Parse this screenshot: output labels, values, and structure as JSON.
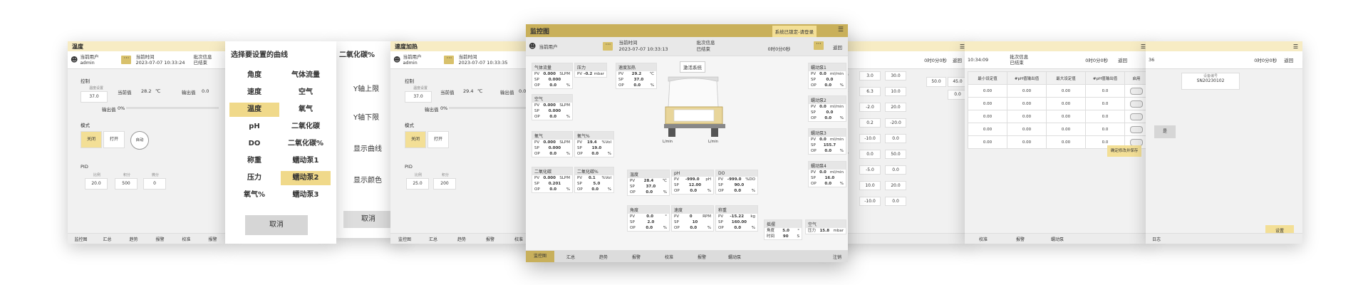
{
  "common": {
    "current_user_label": "当前用户",
    "user_name": "admin",
    "current_time_label": "当前时间",
    "current_time": "2023-07-07 10:33:24",
    "batch_info_label": "批次信息",
    "batch_status": "已结束",
    "dots": "···",
    "back": "返回"
  },
  "panel1": {
    "title": "温度",
    "control": "控制",
    "setpoint_label": "温度设置",
    "setpoint": "37.0",
    "current_value_label": "当前值",
    "current_value": "28.2",
    "unit": "℃",
    "output_label": "输出值",
    "output_value": "0.0",
    "output_value2_label": "输出值",
    "output_pct": "0%",
    "mode": "模式",
    "btn_off": "关闭",
    "btn_on": "打开",
    "btn_auto": "自动",
    "pid": "PID",
    "pid_p_label": "比例",
    "pid_i_label": "积分",
    "pid_d_label": "微分",
    "pid_p": "20.0",
    "pid_i": "500",
    "pid_d": "0",
    "nav": [
      "监控图",
      "汇总",
      "趋势",
      "报警",
      "校准",
      "报警"
    ]
  },
  "panel2": {
    "title": "选择要设置的曲线",
    "items": [
      [
        "角度",
        "气体流量"
      ],
      [
        "速度",
        "空气"
      ],
      [
        "温度",
        "氧气"
      ],
      [
        "pH",
        "二氧化碳"
      ],
      [
        "DO",
        "二氧化碳%"
      ],
      [
        "称重",
        "蠕动泵1"
      ],
      [
        "压力",
        "蠕动泵2"
      ],
      [
        "氧气%",
        "蠕动泵3"
      ]
    ],
    "cancel": "取消"
  },
  "panel3": {
    "title": "二氧化碳%",
    "y_max": "Y轴上限",
    "y_min": "Y轴下限",
    "show_curve": "显示曲线",
    "show_color": "显示颜色",
    "cancel": "取消"
  },
  "panel4": {
    "title": "速度加热",
    "current_time": "2023-07-07 10:33:35",
    "control": "控制",
    "setpoint_label": "温度设置",
    "setpoint": "37.0",
    "current_value_label": "当前值",
    "current_value": "29.4",
    "unit": "℃",
    "output_label": "输出值",
    "output_value": "0.0",
    "output_value2_label": "输出值",
    "output_pct": "0%",
    "mode": "模式",
    "btn_off": "关闭",
    "btn_on": "打开",
    "pid": "PID",
    "pid_p_label": "比例",
    "pid_i_label": "积分",
    "pid_p": "25.0",
    "pid_i": "200",
    "nav": [
      "监控图",
      "汇总",
      "趋势",
      "报警",
      "校准"
    ]
  },
  "panel5": {
    "title": "监控图",
    "notice": "系统已锁定-请登录",
    "current_time": "2023-07-07 10:33:13",
    "run_time": "0时0分0秒",
    "center_label": "激活系统",
    "cards": {
      "gasflow": {
        "title": "气体流量",
        "rows": [
          [
            "PV",
            "0.000",
            "SLPM"
          ],
          [
            "SP",
            "0.000",
            ""
          ],
          [
            "OP",
            "0.0",
            "%"
          ]
        ]
      },
      "pressure": {
        "title": "压力",
        "rows": [
          [
            "PV",
            "-0.2",
            "mbar"
          ]
        ]
      },
      "heat": {
        "title": "速度加热",
        "rows": [
          [
            "PV",
            "29.2",
            "℃"
          ],
          [
            "SP",
            "37.0",
            ""
          ],
          [
            "OP",
            "0.0",
            "%"
          ]
        ]
      },
      "air": {
        "title": "空气",
        "rows": [
          [
            "PV",
            "0.000",
            "SLPM"
          ],
          [
            "SP",
            "0.000",
            ""
          ],
          [
            "OP",
            "0.0",
            "%"
          ]
        ]
      },
      "o2": {
        "title": "氧气",
        "rows": [
          [
            "PV",
            "0.000",
            "SLPM"
          ],
          [
            "SP",
            "0.000",
            ""
          ],
          [
            "OP",
            "0.0",
            "%"
          ]
        ]
      },
      "o2pct": {
        "title": "氧气%",
        "rows": [
          [
            "PV",
            "19.4",
            "%Vol"
          ],
          [
            "SP",
            "19.0",
            ""
          ],
          [
            "OP",
            "0.0",
            "%"
          ]
        ]
      },
      "co2": {
        "title": "二氧化碳",
        "rows": [
          [
            "PV",
            "0.000",
            "SLPM"
          ],
          [
            "SP",
            "0.201",
            ""
          ],
          [
            "OP",
            "0.0",
            "%"
          ]
        ]
      },
      "co2pct": {
        "title": "二氧化碳%",
        "rows": [
          [
            "PV",
            "0.1",
            "%Vol"
          ],
          [
            "SP",
            "5.0",
            ""
          ],
          [
            "OP",
            "0.0",
            "%"
          ]
        ]
      },
      "temp": {
        "title": "温度",
        "rows": [
          [
            "PV",
            "28.4",
            "℃"
          ],
          [
            "SP",
            "37.0",
            ""
          ],
          [
            "OP",
            "0.0",
            "%"
          ]
        ]
      },
      "ph": {
        "title": "pH",
        "rows": [
          [
            "PV",
            "-999.0",
            "pH"
          ],
          [
            "SP",
            "12.00",
            ""
          ],
          [
            "OP",
            "0.0",
            "%"
          ]
        ]
      },
      "do": {
        "title": "DO",
        "rows": [
          [
            "PV",
            "-999.0",
            "%DO"
          ],
          [
            "SP",
            "90.0",
            ""
          ],
          [
            "OP",
            "0.0",
            "%"
          ]
        ]
      },
      "angle": {
        "title": "角度",
        "rows": [
          [
            "PV",
            "0.0",
            "°"
          ],
          [
            "SP",
            "2.0",
            ""
          ],
          [
            "OP",
            "0.0",
            "%"
          ]
        ]
      },
      "speed": {
        "title": "速度",
        "rows": [
          [
            "PV",
            "0",
            "RPM"
          ],
          [
            "SP",
            "10",
            ""
          ],
          [
            "OP",
            "0.0",
            "%"
          ]
        ]
      },
      "weight": {
        "title": "称重",
        "rows": [
          [
            "PV",
            "-15.22",
            "kg"
          ],
          [
            "SP",
            "160.00",
            ""
          ],
          [
            "OP",
            "0.0",
            "%"
          ]
        ]
      },
      "pump1": {
        "title": "蠕动泵1",
        "rows": [
          [
            "PV",
            "0.0",
            "ml/min"
          ],
          [
            "SP",
            "0.0",
            ""
          ],
          [
            "OP",
            "0.0",
            "%"
          ]
        ]
      },
      "pump2": {
        "title": "蠕动泵2",
        "rows": [
          [
            "PV",
            "0.0",
            "ml/min"
          ],
          [
            "SP",
            "0.0",
            ""
          ],
          [
            "OP",
            "0.0",
            "%"
          ]
        ]
      },
      "pump3": {
        "title": "蠕动泵3",
        "rows": [
          [
            "PV",
            "0.0",
            "ml/min"
          ],
          [
            "SP",
            "155.7",
            ""
          ],
          [
            "OP",
            "0.0",
            "%"
          ]
        ]
      },
      "pump4": {
        "title": "蠕动泵4",
        "rows": [
          [
            "PV",
            "0.0",
            "ml/min"
          ],
          [
            "SP",
            "16.0",
            ""
          ],
          [
            "OP",
            "0.0",
            "%"
          ]
        ]
      },
      "rock": {
        "title": "摇摆",
        "rows": [
          [
            "角度",
            "5.0",
            "°"
          ],
          [
            "时间",
            "90",
            "S"
          ]
        ]
      },
      "air2": {
        "title": "空气",
        "rows": [
          [
            "压力",
            "15.8",
            "mbar"
          ]
        ]
      }
    },
    "nav": [
      "监控图",
      "汇总",
      "趋势",
      "报警",
      "校准",
      "报警",
      "蠕动泵"
    ],
    "logout": "注销"
  },
  "panel6": {
    "run_time": "0时0分0秒",
    "col_labels": [
      "测值",
      "最大上限",
      "最低下限"
    ],
    "rows": [
      [
        "0.00",
        "3.0",
        "30.0"
      ],
      [
        "0.02",
        "6.3",
        "10.0"
      ],
      [
        "",
        "-2.0",
        "20.0"
      ],
      [
        "0.0",
        "0.2",
        "-20.0"
      ],
      [
        "",
        "-10.0",
        "0.0"
      ],
      [
        "0.00",
        "0.0",
        "50.0"
      ],
      [
        "",
        "-5.0",
        "0.0"
      ],
      [
        "0.0",
        "10.0",
        "20.0"
      ],
      [
        "",
        "-10.0",
        "0.0"
      ]
    ],
    "right_val": "50.0",
    "right_val2": "45.0",
    "right_val3": "0.0"
  },
  "panel7": {
    "headers": [
      "最小设定值",
      "#pH值输出值",
      "最大设定值",
      "#pH值输出值",
      "启用"
    ],
    "rows": [
      [
        "0.00",
        "0.00",
        "0.00",
        "0.0"
      ],
      [
        "0.00",
        "0.00",
        "0.00",
        "0.0"
      ],
      [
        "0.00",
        "0.00",
        "0.00",
        "0.0"
      ],
      [
        "0.00",
        "0.00",
        "0.00",
        "0.0"
      ],
      [
        "0.00",
        "0.00",
        "0.00",
        "0.0"
      ]
    ],
    "save_btn": "确定修改并保存",
    "time": "10:34:09",
    "nav": [
      "校准",
      "报警",
      "蠕动泵"
    ]
  },
  "panel8": {
    "device_label": "设备编号",
    "device_id": "SN20230102",
    "side_btn": "是",
    "run_time": "0时0分0秒",
    "time": "36",
    "settings_btn": "设置",
    "nav_right": "日志"
  }
}
